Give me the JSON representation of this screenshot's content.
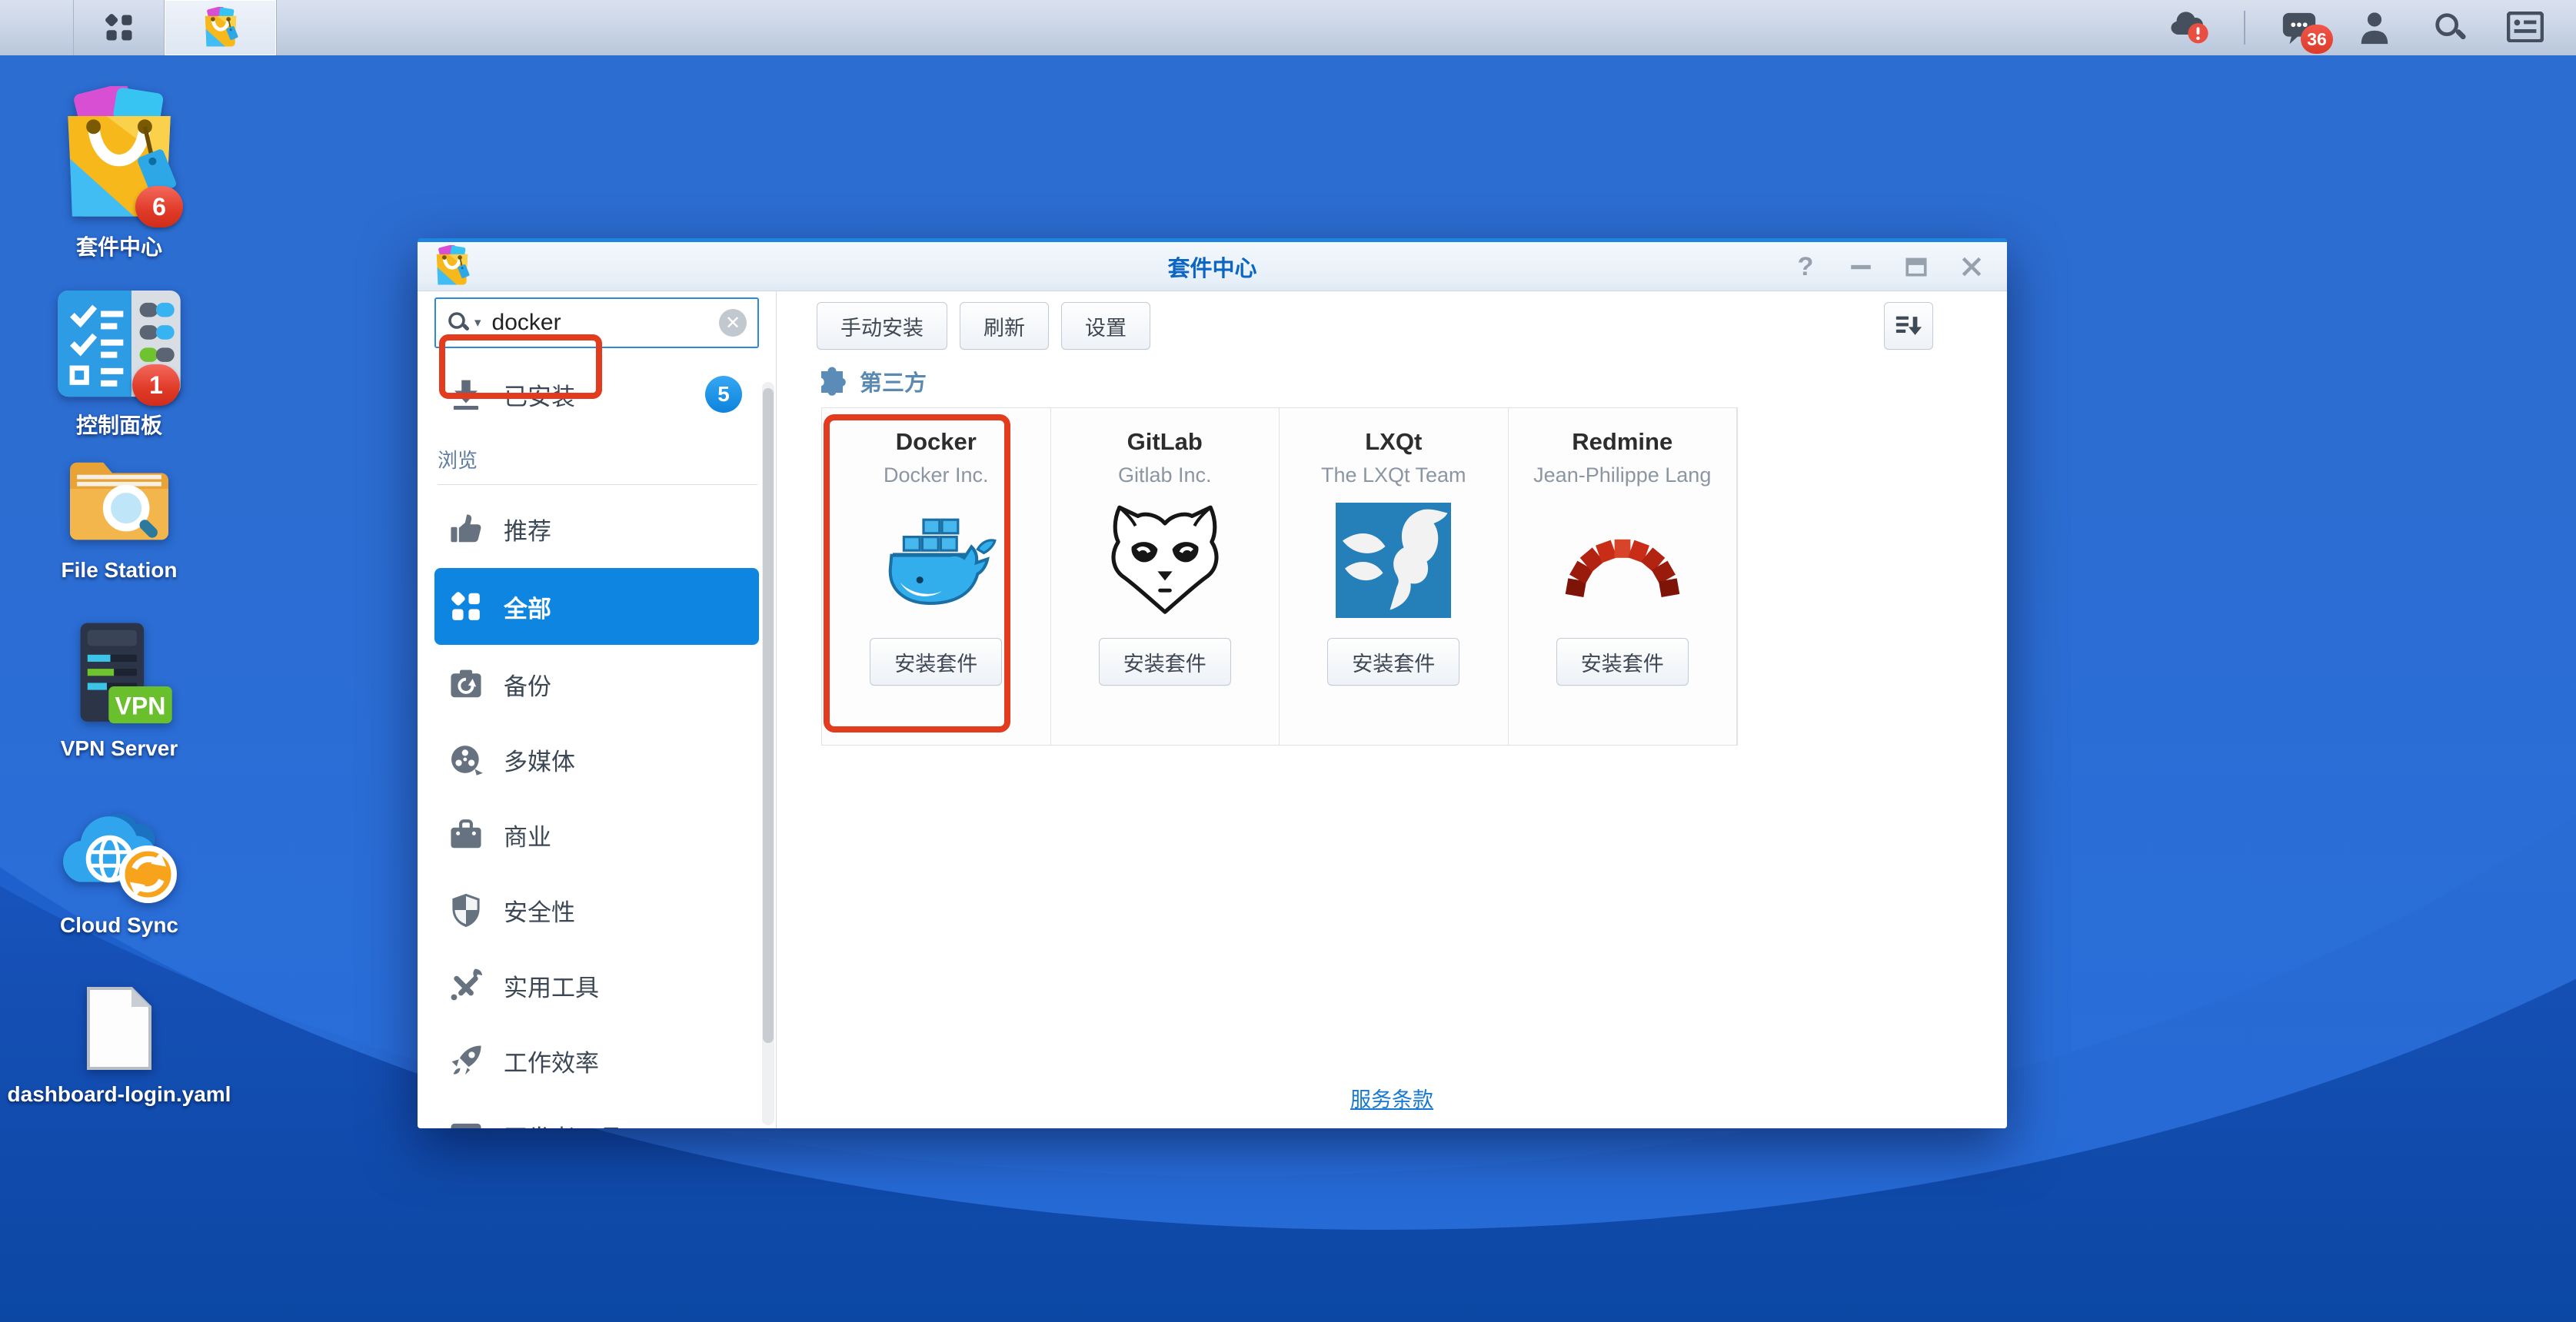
{
  "taskbar": {
    "menu_icon": "menu-grid",
    "app_tab_icon": "pkgcenter",
    "cloud_alert_badge": "!",
    "chat_badge": "36"
  },
  "desktop": {
    "icons": [
      {
        "label": "套件中心",
        "icon": "pkgcenter",
        "badge": "6"
      },
      {
        "label": "控制面板",
        "icon": "control-panel",
        "badge": "1"
      },
      {
        "label": "File Station",
        "icon": "file-station"
      },
      {
        "label": "VPN Server",
        "icon": "vpn-server"
      },
      {
        "label": "Cloud Sync",
        "icon": "cloud-sync"
      },
      {
        "label": "dashboard-login.yaml",
        "icon": "yaml-file"
      }
    ]
  },
  "window": {
    "title": "套件中心",
    "controls": {
      "help_label": "?"
    },
    "sidebar": {
      "search": {
        "value": "docker"
      },
      "installed": {
        "label": "已安装",
        "badge": "5"
      },
      "browse_label": "浏览",
      "items": [
        {
          "label": "推荐",
          "icon": "thumb"
        },
        {
          "label": "全部",
          "icon": "grid",
          "selected": true
        },
        {
          "label": "备份",
          "icon": "backup"
        },
        {
          "label": "多媒体",
          "icon": "film"
        },
        {
          "label": "商业",
          "icon": "briefcase"
        },
        {
          "label": "安全性",
          "icon": "shield"
        },
        {
          "label": "实用工具",
          "icon": "tools"
        },
        {
          "label": "工作效率",
          "icon": "rocket"
        },
        {
          "label": "开发者工具",
          "icon": "terminal"
        }
      ]
    },
    "toolbar": {
      "buttons": [
        {
          "label": "手动安装"
        },
        {
          "label": "刷新"
        },
        {
          "label": "设置"
        }
      ]
    },
    "section": {
      "label": "第三方"
    },
    "cards": [
      {
        "name": "Docker",
        "publisher": "Docker Inc.",
        "install_label": "安装套件",
        "icon": "docker",
        "highlighted": true
      },
      {
        "name": "GitLab",
        "publisher": "Gitlab Inc.",
        "install_label": "安装套件",
        "icon": "gitlab"
      },
      {
        "name": "LXQt",
        "publisher": "The LXQt Team",
        "install_label": "安装套件",
        "icon": "lxqt"
      },
      {
        "name": "Redmine",
        "publisher": "Jean-Philippe Lang",
        "install_label": "安装套件",
        "icon": "redmine"
      }
    ],
    "footer_link": "服务条款"
  },
  "colors": {
    "accent_blue": "#0e86e1",
    "annotation_red": "#e23b1e",
    "badge_red": "#e03a27",
    "badge_blue": "#1296ed",
    "title_blue": "#0a65c4"
  }
}
